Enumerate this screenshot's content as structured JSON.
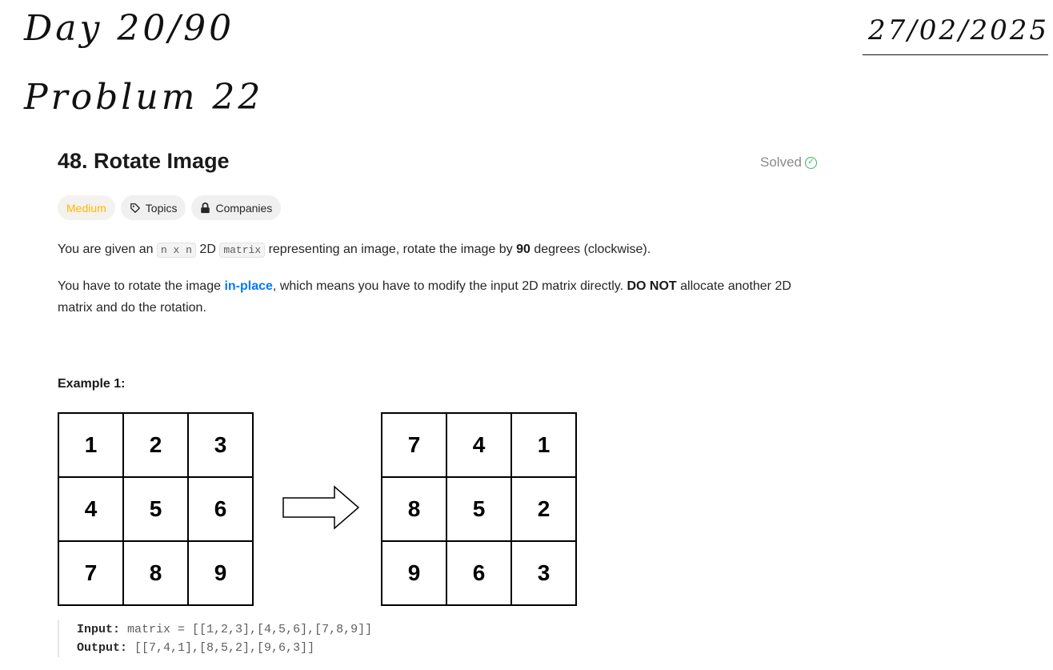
{
  "handwriting": {
    "day": "Day 20/90",
    "problem": "Problum 22",
    "date": "27/02/2025"
  },
  "problem": {
    "title": "48. Rotate Image",
    "status": "Solved",
    "tags": {
      "difficulty": "Medium",
      "topics": "Topics",
      "companies": "Companies"
    },
    "difficulty_color": "#ffb800",
    "status_color": "#2cbb5d",
    "description": {
      "p1_before": "You are given an ",
      "p1_code1": "n x n",
      "p1_mid": " 2D ",
      "p1_code2": "matrix",
      "p1_after": " representing an image, rotate the image by ",
      "p1_bold": "90",
      "p1_end": " degrees (clockwise).",
      "p2_before": "You have to rotate the image ",
      "p2_link": "in-place",
      "p2_mid": ", which means you have to modify the input 2D matrix directly. ",
      "p2_bold": "DO NOT",
      "p2_end": " allocate another 2D matrix and do the rotation."
    },
    "example": {
      "title": "Example 1:",
      "input_matrix": [
        [
          "1",
          "2",
          "3"
        ],
        [
          "4",
          "5",
          "6"
        ],
        [
          "7",
          "8",
          "9"
        ]
      ],
      "output_matrix": [
        [
          "7",
          "4",
          "1"
        ],
        [
          "8",
          "5",
          "2"
        ],
        [
          "9",
          "6",
          "3"
        ]
      ],
      "input_label": "Input:",
      "input_value": "matrix = [[1,2,3],[4,5,6],[7,8,9]]",
      "output_label": "Output:",
      "output_value": "[[7,4,1],[8,5,2],[9,6,3]]"
    }
  }
}
